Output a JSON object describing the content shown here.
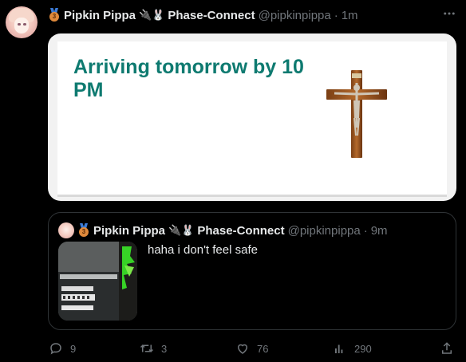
{
  "tweet": {
    "author_name": "Pipkin Pippa",
    "medal_number": "3",
    "team_emoji": "🔌🐰",
    "team_name": "Phase-Connect",
    "handle": "@pipkinpippa",
    "separator": "·",
    "time": "1m",
    "more_icon": "more-horizontal-icon",
    "card": {
      "title": "Arriving tomorrow by 10 PM",
      "title_color": "#0e7a70",
      "image": "crucifix"
    }
  },
  "quote": {
    "author_name": "Pipkin Pippa",
    "medal_number": "3",
    "team_emoji": "🔌🐰",
    "team_name": "Phase-Connect",
    "handle": "@pipkinpippa",
    "separator": "·",
    "time": "9m",
    "text": "haha i don't feel safe"
  },
  "actions": {
    "reply_count": "9",
    "retweet_count": "3",
    "like_count": "76",
    "views_count": "290"
  },
  "colors": {
    "background": "#000000",
    "text": "#e7e9ea",
    "muted": "#71767b",
    "border": "#2f3336"
  }
}
